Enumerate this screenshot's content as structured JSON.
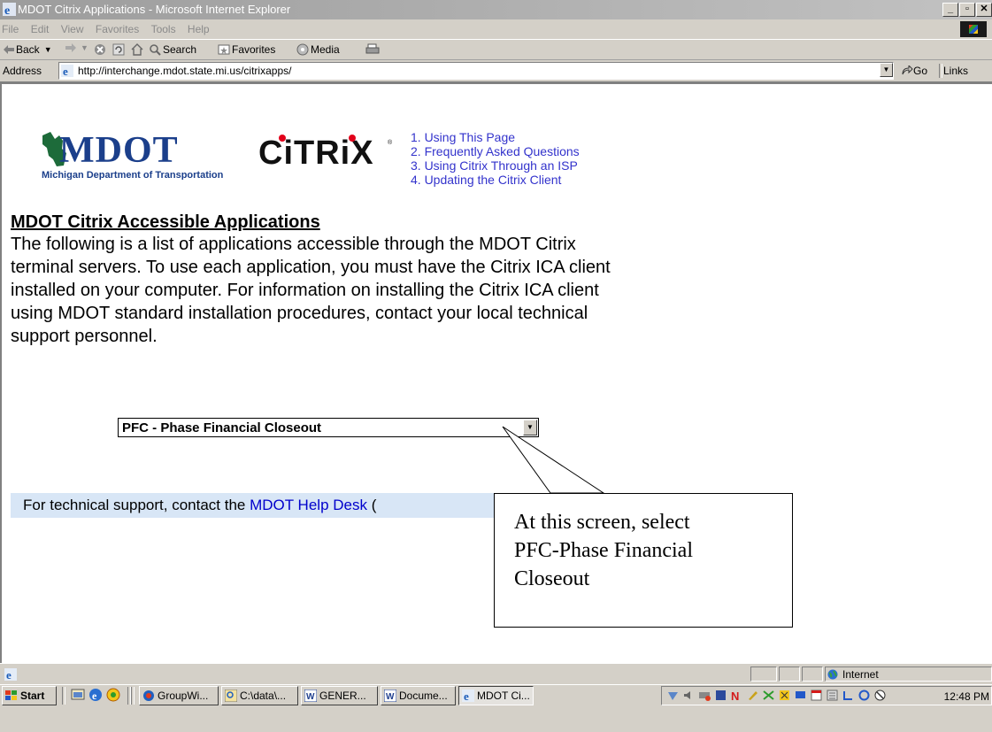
{
  "window": {
    "title": "MDOT Citrix Applications - Microsoft Internet Explorer",
    "buttons": [
      "_",
      "▫",
      "✕"
    ]
  },
  "menubar": {
    "items": [
      "File",
      "Edit",
      "View",
      "Favorites",
      "Tools",
      "Help"
    ]
  },
  "toolbar": {
    "back": "Back",
    "search": "Search",
    "favorites": "Favorites",
    "media": "Media"
  },
  "address": {
    "label": "Address",
    "url": "http://interchange.mdot.state.mi.us/citrixapps/",
    "go": "Go",
    "links": "Links"
  },
  "page": {
    "mdot_logo": {
      "text": "MDOT",
      "subtitle": "Michigan Department of Transportation"
    },
    "citrix_logo": {
      "text": "CiTRiX"
    },
    "toc": [
      "1. Using This Page",
      "2. Frequently Asked Questions",
      "3. Using Citrix Through an ISP",
      "4. Updating the Citrix Client"
    ],
    "heading": "MDOT Citrix Accessible Applications",
    "intro": "The following is a list of applications accessible through the MDOT Citrix terminal servers.  To use each application, you must have the Citrix ICA client installed on your computer.  For information on installing the Citrix ICA client using MDOT standard installation procedures, contact your local technical support personnel.",
    "app_select": {
      "value": "PFC - Phase Financial Closeout"
    },
    "support": {
      "prefix": "For technical support, contact the ",
      "link": "MDOT Help Desk",
      "suffix": " ("
    }
  },
  "callout": {
    "lines": [
      "At this screen, select",
      "PFC-Phase Financial",
      "Closeout"
    ]
  },
  "statusbar": {
    "zone": "Internet"
  },
  "taskbar": {
    "start": "Start",
    "tasks": [
      "GroupWi...",
      "C:\\data\\...",
      "GENER...",
      "Docume...",
      "MDOT Ci..."
    ],
    "clock": "12:48 PM"
  },
  "colors": {
    "link": "#3333cc",
    "support_bg": "#d8e6f6",
    "chrome": "#d4d0c8",
    "mdot_blue": "#1b3f8b",
    "mdot_green": "#1d6b3a",
    "citrix_red": "#e2001a"
  }
}
